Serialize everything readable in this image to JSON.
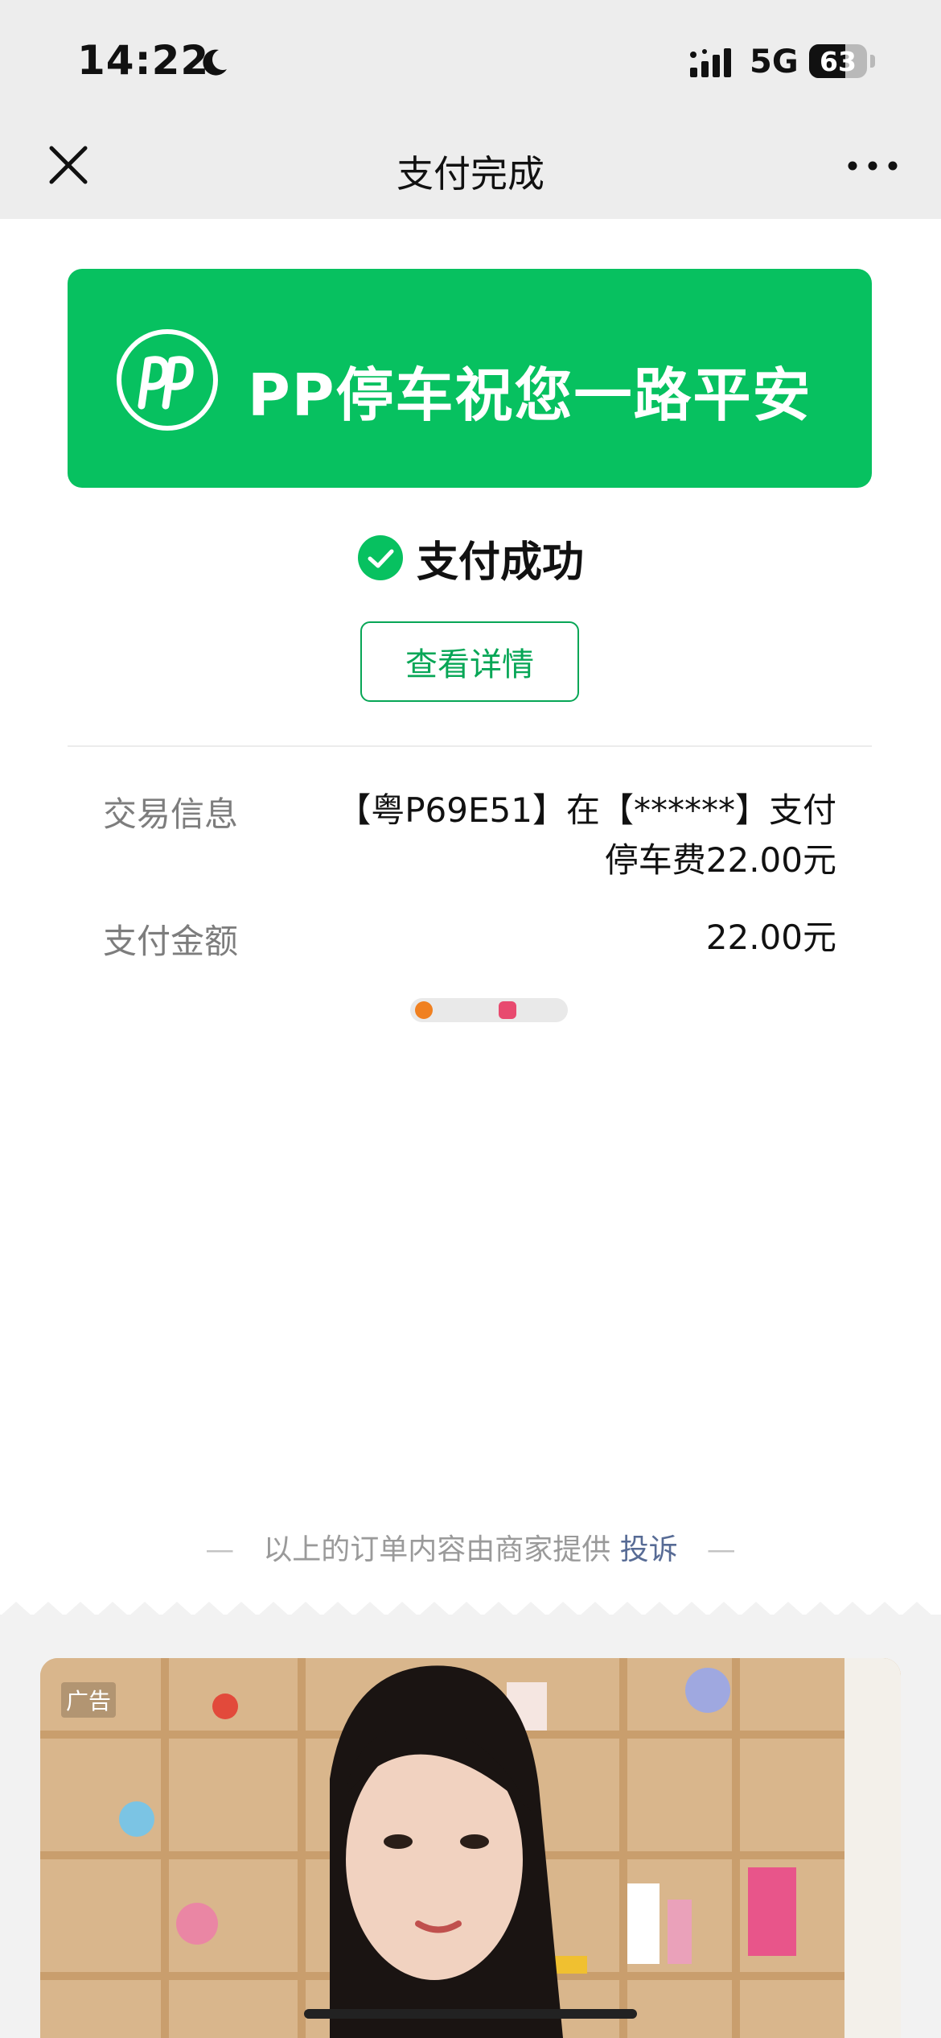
{
  "status_bar": {
    "time": "14:22",
    "network": "5G",
    "battery": "63",
    "battery_level_percent": 63
  },
  "nav": {
    "title": "支付完成"
  },
  "banner": {
    "text": "PP停车祝您一路平安",
    "color": "#07c160"
  },
  "payment": {
    "status": "支付成功",
    "details_button": "查看详情",
    "rows": [
      {
        "label": "交易信息",
        "value_line1": "【粤P69E51】在【******】支付",
        "value_line2": "停车费22.00元"
      },
      {
        "label": "支付金额",
        "value": "22.00元"
      }
    ]
  },
  "footer": {
    "note": "以上的订单内容由商家提供",
    "complaint_link": "投诉"
  },
  "ad": {
    "label": "广告"
  },
  "icons": [
    "moon-icon",
    "signal-icon",
    "close-icon",
    "more-icon",
    "brand-logo",
    "checkmark-circle-icon"
  ],
  "colors": {
    "accent": "#07c160",
    "link": "#576b95",
    "nav_bg": "#ededed"
  }
}
